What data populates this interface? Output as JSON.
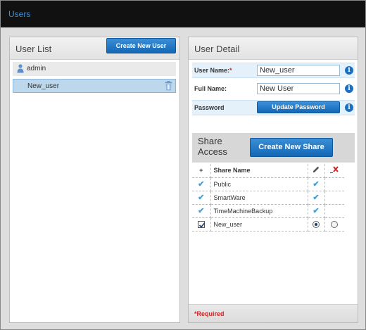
{
  "app": {
    "title": "Users"
  },
  "user_list": {
    "title": "User List",
    "create_button": "Create New User",
    "users": [
      {
        "name": "admin",
        "icon": "user-icon",
        "selected": false
      },
      {
        "name": "New_user",
        "icon": "",
        "selected": true
      }
    ]
  },
  "user_detail": {
    "title": "User Detail",
    "user_name_label": "User Name:",
    "required_marker": "*",
    "user_name_value": "New_user",
    "full_name_label": "Full Name:",
    "full_name_value": "New User",
    "password_label": "Password",
    "update_password_button": "Update Password",
    "info_glyph": "i"
  },
  "share_access": {
    "title": "Share Access",
    "create_share_button": "Create New Share",
    "columns": {
      "add": "+",
      "name": "Share Name"
    },
    "rows": [
      {
        "name": "Public",
        "access": "check",
        "write": "check",
        "deny": ""
      },
      {
        "name": "SmartWare",
        "access": "check",
        "write": "check",
        "deny": ""
      },
      {
        "name": "TimeMachineBackup",
        "access": "check",
        "write": "check",
        "deny": ""
      },
      {
        "name": "New_user",
        "access": "checkbox-checked",
        "write": "radio-selected",
        "deny": "radio-unselected"
      }
    ]
  },
  "footer": {
    "required_note": "*Required"
  },
  "colors": {
    "accent": "#1467b4",
    "title_link": "#3d8fd6",
    "required": "#d82020",
    "selected_row": "#bdd8ec"
  }
}
